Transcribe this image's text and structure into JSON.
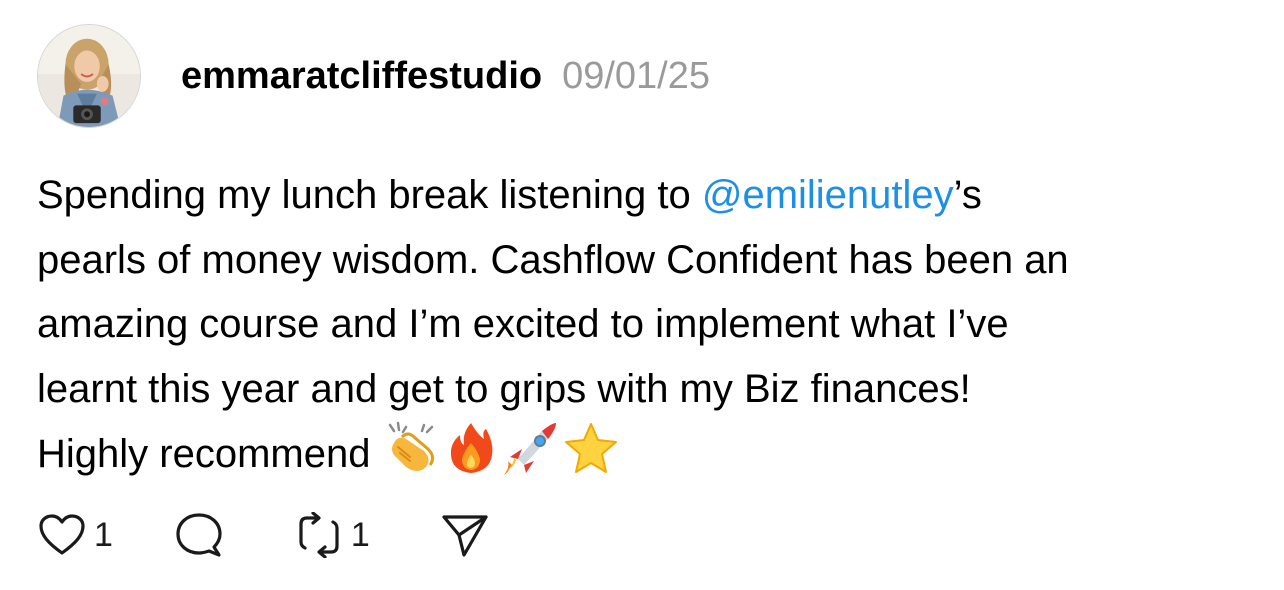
{
  "post": {
    "username": "emmaratcliffestudio",
    "date": "09/01/25",
    "body": {
      "line1_before": "Spending my lunch break listening to ",
      "mention": "@emilienutley",
      "line1_after": "’s",
      "line2": "pearls of money wisdom. Cashflow Confident has been an",
      "line3": "amazing course and I’m excited to implement what I’ve",
      "line4": "learnt this year and get to grips with my Biz finances!",
      "line5": "Highly recommend"
    },
    "emojis": [
      "clapping-hands",
      "fire",
      "rocket",
      "star"
    ]
  },
  "actions": {
    "like_count": "1",
    "repost_count": "1"
  },
  "colors": {
    "mention": "#1d8fe6",
    "date": "#9a9a9a",
    "text": "#000000"
  }
}
